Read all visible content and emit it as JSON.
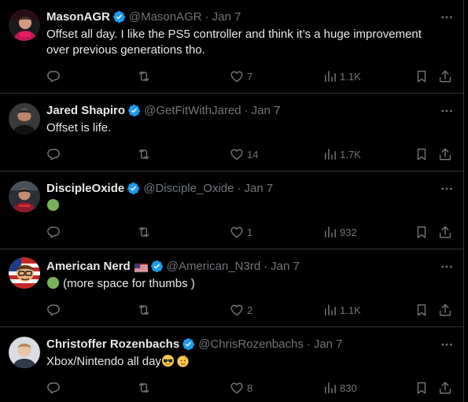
{
  "tweets": [
    {
      "name": "MasonAGR",
      "handle": "@MasonAGR",
      "dot": "·",
      "date": "Jan 7",
      "text_lines": [
        "Offset all day. I like the PS5 controller and think it’s a huge improvement",
        "over previous generations tho."
      ],
      "replies": "",
      "retweets": "",
      "likes": "7",
      "views": "1.1K"
    },
    {
      "name": "Jared Shapiro",
      "handle": "@GetFitWithJared",
      "dot": "·",
      "date": "Jan 7",
      "text_lines": [
        "Offset is life."
      ],
      "replies": "",
      "retweets": "",
      "likes": "14",
      "views": "1.7K"
    },
    {
      "name": "DiscipleOxide",
      "handle": "@Disciple_Oxide",
      "dot": "·",
      "date": "Jan 7",
      "emoji": "green-circle",
      "text": "",
      "replies": "",
      "retweets": "",
      "likes": "1",
      "views": "932"
    },
    {
      "name": "American Nerd",
      "flag": "us-flag",
      "handle": "@American_N3rd",
      "dot": "·",
      "date": "Jan 7",
      "emoji": "green-circle",
      "text": "(more space for thumbs )",
      "replies": "",
      "retweets": "",
      "likes": "2",
      "views": "1.1K"
    },
    {
      "name": "Christoffer Rozenbachs",
      "handle": "@ChrisRozenbachs",
      "dot": "·",
      "date": "Jan 7",
      "text": "Xbox/Nintendo all day",
      "emojis": [
        "sunglasses-face",
        "saluting-face"
      ],
      "replies": "",
      "retweets": "",
      "likes": "8",
      "views": "830"
    }
  ],
  "colors": {
    "background": "#000000",
    "text": "#e7e9ea",
    "muted": "#71767b",
    "divider": "#2f3336",
    "verified": "#1d9bf0"
  },
  "icons": [
    "reply-icon",
    "retweet-icon",
    "like-icon",
    "views-icon",
    "bookmark-icon",
    "share-icon",
    "more-icon",
    "verified-badge-icon"
  ]
}
